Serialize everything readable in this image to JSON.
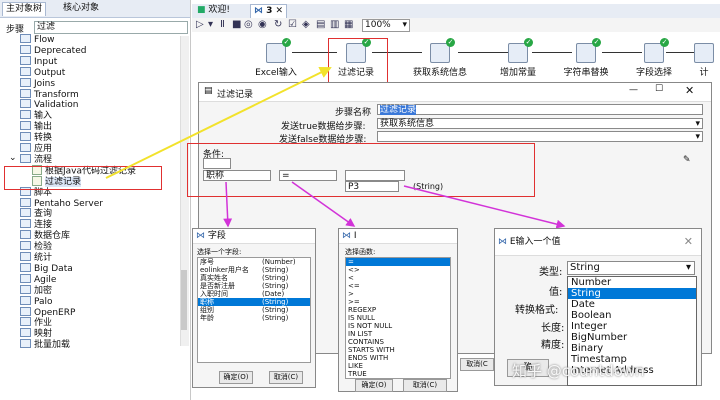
{
  "left": {
    "tabs": [
      "主对象树",
      "核心对象"
    ],
    "step_label": "步骤",
    "search_value": "过滤",
    "tree": [
      "Flow",
      "Deprecated",
      "Input",
      "Output",
      "Joins",
      "Transform",
      "Validation",
      "输入",
      "输出",
      "转换",
      "应用",
      "流程",
      "根据Java代码过滤记录",
      "过滤记录",
      "脚本",
      "Pentaho Server",
      "查询",
      "连接",
      "数据仓库",
      "检验",
      "统计",
      "Big Data",
      "Agile",
      "加密",
      "Palo",
      "OpenERP",
      "作业",
      "映射",
      "批量加载"
    ]
  },
  "top": {
    "tabs": [
      "欢迎!",
      "3"
    ],
    "zoom": "100%"
  },
  "canvas": {
    "steps": [
      "Excel输入",
      "过滤记录",
      "获取系统信息",
      "增加常量",
      "字符串替换",
      "字段选择",
      "计"
    ]
  },
  "dialog": {
    "title": "过滤记录",
    "step_name_label": "步骤名称",
    "step_name_value": "过滤记录",
    "true_label": "发送true数据给步骤:",
    "true_value": "获取系统信息",
    "false_label": "发送false数据给步骤:",
    "false_value": "",
    "condition_label": "条件:",
    "cond_field": "职称",
    "cond_op": "=",
    "cond_value": "P3",
    "cond_type": "(String)"
  },
  "field_popup": {
    "title": "字段",
    "subtitle": "选择一个字段:",
    "items": [
      {
        "name": "序号",
        "type": "(Number)"
      },
      {
        "name": "eolinker用户名",
        "type": "(String)"
      },
      {
        "name": "真实姓名",
        "type": "(String)"
      },
      {
        "name": "是否新注册",
        "type": "(String)"
      },
      {
        "name": "入职时间",
        "type": "(Date)"
      },
      {
        "name": "职称",
        "type": "(String)"
      },
      {
        "name": "组别",
        "type": "(String)"
      },
      {
        "name": "年龄",
        "type": "(String)"
      }
    ],
    "ok": "确定(O)",
    "cancel": "取消(C)"
  },
  "func_popup": {
    "title": "I",
    "subtitle": "选择函数:",
    "items": [
      "=",
      "<>",
      "<",
      "<=",
      ">",
      ">=",
      "REGEXP",
      "IS NULL",
      "IS NOT NULL",
      "IN LIST",
      "CONTAINS",
      "STARTS WITH",
      "ENDS WITH",
      "LIKE",
      "TRUE"
    ],
    "ok": "确定(O)",
    "cancel": "取消(C)"
  },
  "value_popup": {
    "title": "E输入一个值",
    "type_label": "类型:",
    "type_value": "String",
    "value_label": "值:",
    "format_label": "转换格式:",
    "length_label": "长度:",
    "precision_label": "精度:",
    "ok_partial": "确",
    "cancel_partial": "取消(C",
    "options": [
      "Number",
      "String",
      "Date",
      "Boolean",
      "Integer",
      "BigNumber",
      "Binary",
      "Timestamp",
      "Internet Address"
    ]
  },
  "watermark": "知乎 @countdown"
}
